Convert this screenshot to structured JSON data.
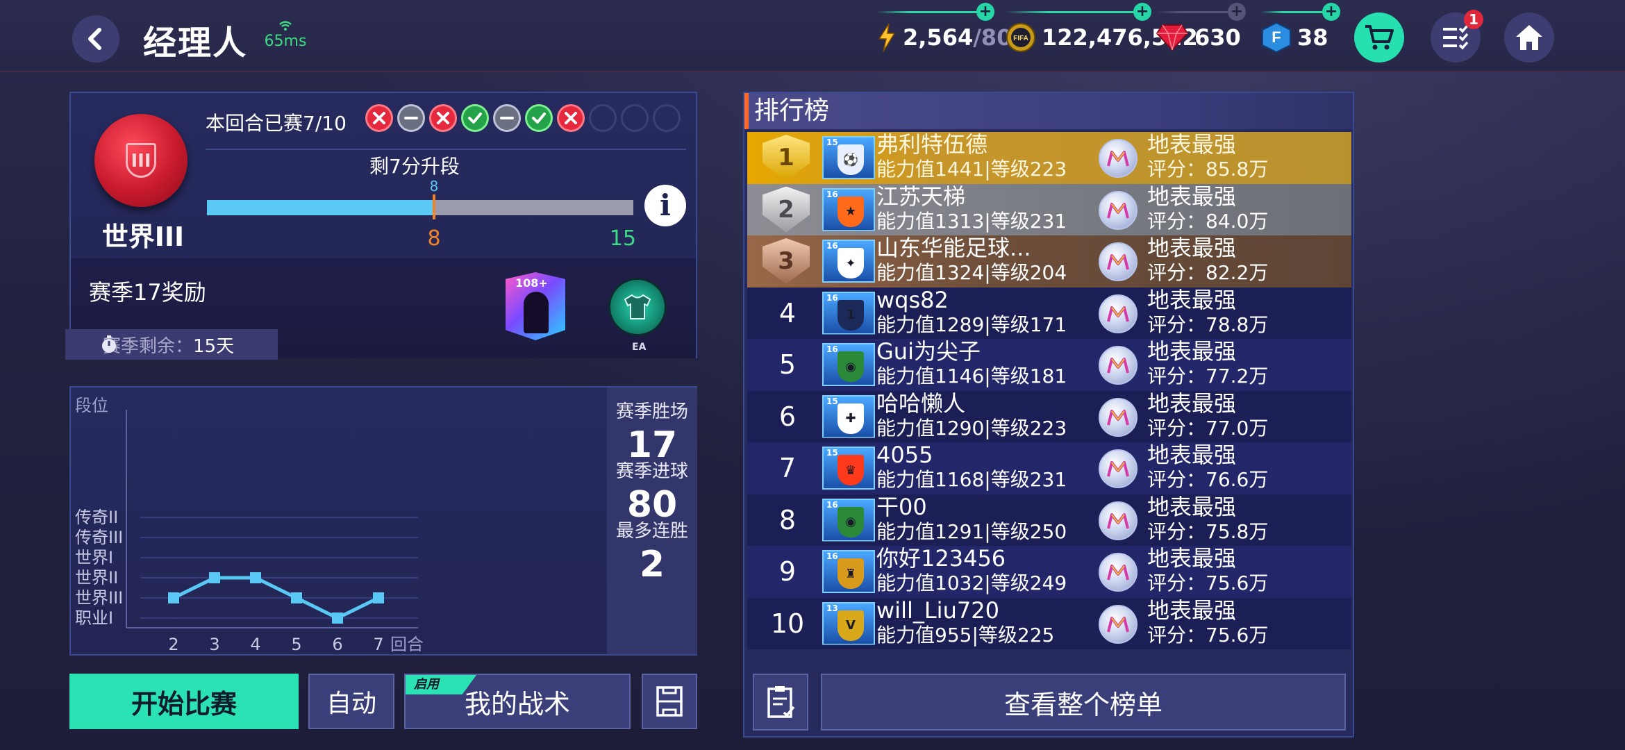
{
  "header": {
    "title": "经理人",
    "ping": "65ms",
    "energy_current": "2,564",
    "energy_max": "/80",
    "coins": "122,476,522",
    "gems": "630",
    "fifa_points": "38",
    "task_badge": "1"
  },
  "rank_panel": {
    "tier_label": "世界III",
    "tier_numeral": "III",
    "progress_label": "本回合已赛7/10",
    "match_results": [
      "loss",
      "draw",
      "loss",
      "win",
      "draw",
      "win",
      "loss",
      "empty",
      "empty",
      "empty"
    ],
    "promotion_text": "剩7分升段",
    "progress_value": 8,
    "progress_max": 15,
    "progress_value_label": "8",
    "progress_marker_label": "8",
    "progress_max_label": "15",
    "reward_label": "赛季17奖励",
    "reward_card_rating": "108+",
    "reward_kit_brand": "EA",
    "season_remaining_label": "赛季剩余：",
    "season_remaining_value": "15天"
  },
  "chart_panel": {
    "stats": [
      {
        "label": "赛季胜场",
        "value": "17"
      },
      {
        "label": "赛季进球",
        "value": "80"
      },
      {
        "label": "最多连胜",
        "value": "2"
      }
    ]
  },
  "chart_data": {
    "type": "line",
    "title": "",
    "ylabel": "段位",
    "xlabel": "回合",
    "y_categories": [
      "职业I",
      "世界III",
      "世界II",
      "世界I",
      "传奇III",
      "传奇II"
    ],
    "x": [
      2,
      3,
      4,
      5,
      6,
      7
    ],
    "series": [
      {
        "values": [
          "世界III",
          "世界II",
          "世界II",
          "世界III",
          "职业I",
          "世界III"
        ]
      }
    ],
    "grid": true
  },
  "buttons": {
    "start": "开始比赛",
    "auto": "自动",
    "tactic": "我的战术",
    "tactic_tag": "启用"
  },
  "leaderboard": {
    "title": "排行榜",
    "view_all": "查看整个榜单",
    "rows": [
      {
        "rank": "1",
        "level": "15",
        "name": "弗利特伍德",
        "info": "能力值1441|等级223",
        "league": "地表最强",
        "score": "评分：85.8万"
      },
      {
        "rank": "2",
        "level": "16",
        "name": "江苏天梯",
        "info": "能力值1313|等级231",
        "league": "地表最强",
        "score": "评分：84.0万"
      },
      {
        "rank": "3",
        "level": "16",
        "name": "山东华能足球...",
        "info": "能力值1324|等级204",
        "league": "地表最强",
        "score": "评分：82.2万"
      },
      {
        "rank": "4",
        "level": "16",
        "name": "wqs82",
        "info": "能力值1289|等级171",
        "league": "地表最强",
        "score": "评分：78.8万"
      },
      {
        "rank": "5",
        "level": "16",
        "name": "Gui为尖子",
        "info": "能力值1146|等级181",
        "league": "地表最强",
        "score": "评分：77.2万"
      },
      {
        "rank": "6",
        "level": "15",
        "name": "哈哈懒人",
        "info": "能力值1290|等级223",
        "league": "地表最强",
        "score": "评分：77.0万"
      },
      {
        "rank": "7",
        "level": "15",
        "name": "4055",
        "info": "能力值1168|等级231",
        "league": "地表最强",
        "score": "评分：76.6万"
      },
      {
        "rank": "8",
        "level": "16",
        "name": "干00",
        "info": "能力值1291|等级250",
        "league": "地表最强",
        "score": "评分：75.8万"
      },
      {
        "rank": "9",
        "level": "16",
        "name": "你好123456",
        "info": "能力值1032|等级249",
        "league": "地表最强",
        "score": "评分：75.6万"
      },
      {
        "rank": "10",
        "level": "13",
        "name": "will_Liu720",
        "info": "能力值955|等级225",
        "league": "地表最强",
        "score": "评分：75.6万"
      }
    ]
  },
  "colors": {
    "accent": "#2be2b4",
    "loss": "#e5283d",
    "win": "#24a24a",
    "draw": "#6b6f82",
    "progress": "#5ac8f4",
    "marker": "#f08428"
  }
}
